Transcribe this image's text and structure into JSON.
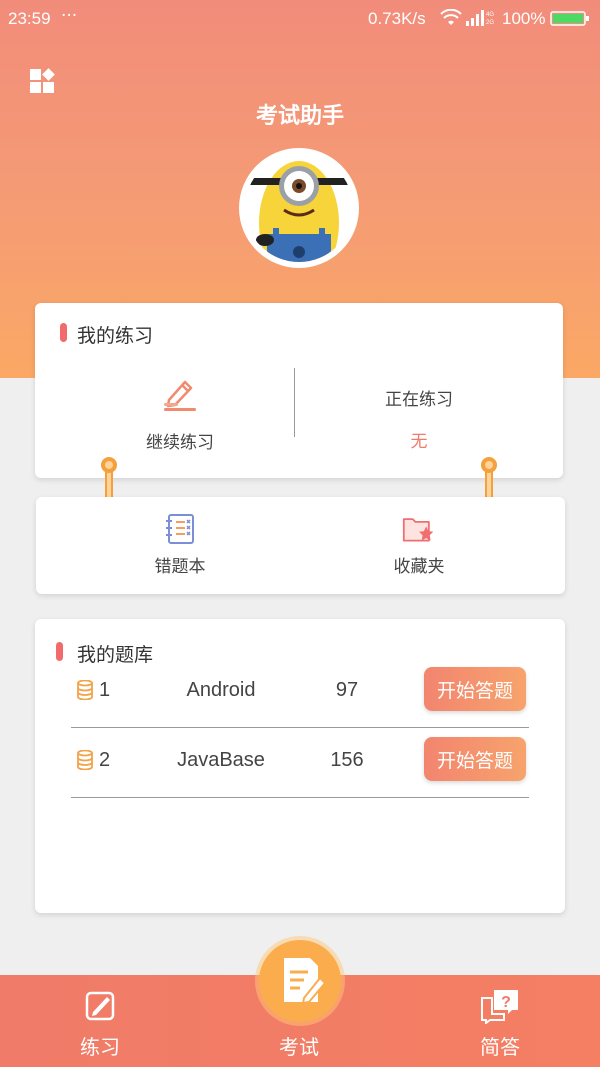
{
  "status_bar": {
    "time": "23:59",
    "dots": "···",
    "speed": "0.73K/s",
    "battery_pct": "100%"
  },
  "header": {
    "title": "考试助手",
    "menu_icon": "grid-menu-icon",
    "avatar": "minion-avatar"
  },
  "practice": {
    "title": "我的练习",
    "continue_label": "继续练习",
    "current_label": "正在练习",
    "current_value": "无"
  },
  "tools": {
    "wrong_book_label": "错题本",
    "favorites_label": "收藏夹"
  },
  "bank": {
    "title": "我的题库",
    "rows": [
      {
        "index": "1",
        "name": "Android",
        "count": "97",
        "button": "开始答题"
      },
      {
        "index": "2",
        "name": "JavaBase",
        "count": "156",
        "button": "开始答题"
      }
    ]
  },
  "bottom_nav": {
    "practice_label": "练习",
    "exam_label": "考试",
    "qa_label": "简答"
  },
  "colors": {
    "header_top": "#f18c7a",
    "header_bottom": "#fba865",
    "accent_red": "#f26a6a",
    "fab_orange": "#fbac4c",
    "nav_bg": "#f07b68"
  }
}
